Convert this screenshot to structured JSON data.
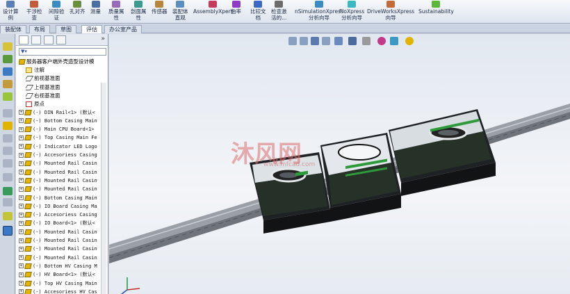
{
  "ribbon": {
    "items": [
      {
        "label1": "设计算",
        "label2": "例",
        "color": "#5b7fb8"
      },
      {
        "label1": "干涉检",
        "label2": "查",
        "color": "#c45b3b"
      },
      {
        "label1": "间隙验",
        "label2": "证",
        "color": "#3b8bc4"
      },
      {
        "label1": "孔对齐",
        "label2": "",
        "color": "#6b8f3b"
      },
      {
        "label1": "测量",
        "label2": "",
        "color": "#4a6fa0"
      },
      {
        "label1": "质量属",
        "label2": "性",
        "color": "#9a6bb8"
      },
      {
        "label1": "剖面属",
        "label2": "性",
        "color": "#3b9a8f"
      },
      {
        "label1": "传感器",
        "label2": "",
        "color": "#b8863b"
      },
      {
        "label1": "装配体",
        "label2": "直观",
        "color": "#5b8fc4"
      },
      {
        "label1": "AssemblyXpert",
        "label2": "",
        "color": "#c43b5b"
      },
      {
        "label1": "曲率",
        "label2": "",
        "color": "#8f3bc4"
      },
      {
        "label1": "比较文",
        "label2": "档",
        "color": "#3b6bc4"
      },
      {
        "label1": "检查激",
        "label2": "活的...",
        "color": "#6b6b6b"
      },
      {
        "label1": "nSimulationXpress",
        "label2": "分析向导",
        "color": "#3b8bc4"
      },
      {
        "label1": "FloXpress",
        "label2": "分析向导",
        "color": "#3bb8c4"
      },
      {
        "label1": "DriveWorksXpress",
        "label2": "向导",
        "color": "#c46b3b"
      },
      {
        "label1": "Sustainability",
        "label2": "",
        "color": "#5bb83b"
      }
    ]
  },
  "tabs": [
    "装配体",
    "布局",
    "草图",
    "评估",
    "办公室产品"
  ],
  "active_tab": "评估",
  "tree": {
    "root": "服务器客户端外壳造型设计模",
    "items": [
      {
        "label": "注解",
        "type": "annotation"
      },
      {
        "label": "前视基准面",
        "type": "plane"
      },
      {
        "label": "上视基准面",
        "type": "plane"
      },
      {
        "label": "右视基准面",
        "type": "plane"
      },
      {
        "label": "原点",
        "type": "origin"
      },
      {
        "label": "(-) DIN Rail<1> (默认<",
        "type": "part"
      },
      {
        "label": "(-) Bottom Casing Main",
        "type": "part"
      },
      {
        "label": "(-) Main CPU Board<1>",
        "type": "part"
      },
      {
        "label": "(-) Top Casing Main Fe",
        "type": "part"
      },
      {
        "label": "(-) Indicator LED Logo",
        "type": "part"
      },
      {
        "label": "(-) Accesoriess Casing",
        "type": "part"
      },
      {
        "label": "(-) Mounted Rail Casin",
        "type": "part"
      },
      {
        "label": "(-) Mounted Rail Casin",
        "type": "part"
      },
      {
        "label": "(-) Mounted Rail Casin",
        "type": "part"
      },
      {
        "label": "(-) Mounted Rail Casin",
        "type": "part"
      },
      {
        "label": "(-) Bottom Casing Main",
        "type": "part"
      },
      {
        "label": "(-) IO Board Casing Ma",
        "type": "part"
      },
      {
        "label": "(-) Accesoriess Casing",
        "type": "part"
      },
      {
        "label": "(-) IO Board<1> (默认<",
        "type": "part"
      },
      {
        "label": "(-) Mounted Rail Casin",
        "type": "part"
      },
      {
        "label": "(-) Mounted Rail Casin",
        "type": "part"
      },
      {
        "label": "(-) Mounted Rail Casin",
        "type": "part"
      },
      {
        "label": "(-) Mounted Rail Casin",
        "type": "part"
      },
      {
        "label": "(-) Bottom HV Casing M",
        "type": "part"
      },
      {
        "label": "(-) HV Board<1> (默认<",
        "type": "part"
      },
      {
        "label": "(-) Top HV Casing Main",
        "type": "part"
      },
      {
        "label": "(-) Accesoriess HV Cas",
        "type": "part"
      }
    ]
  },
  "watermark": {
    "text": "沐风网",
    "sub": "www.mfcad.com"
  },
  "colors": {
    "accent": "#2c5aa0",
    "part": "#e0b400",
    "casing_dark": "#2a2d30",
    "pcb": "#2e9a3a"
  }
}
